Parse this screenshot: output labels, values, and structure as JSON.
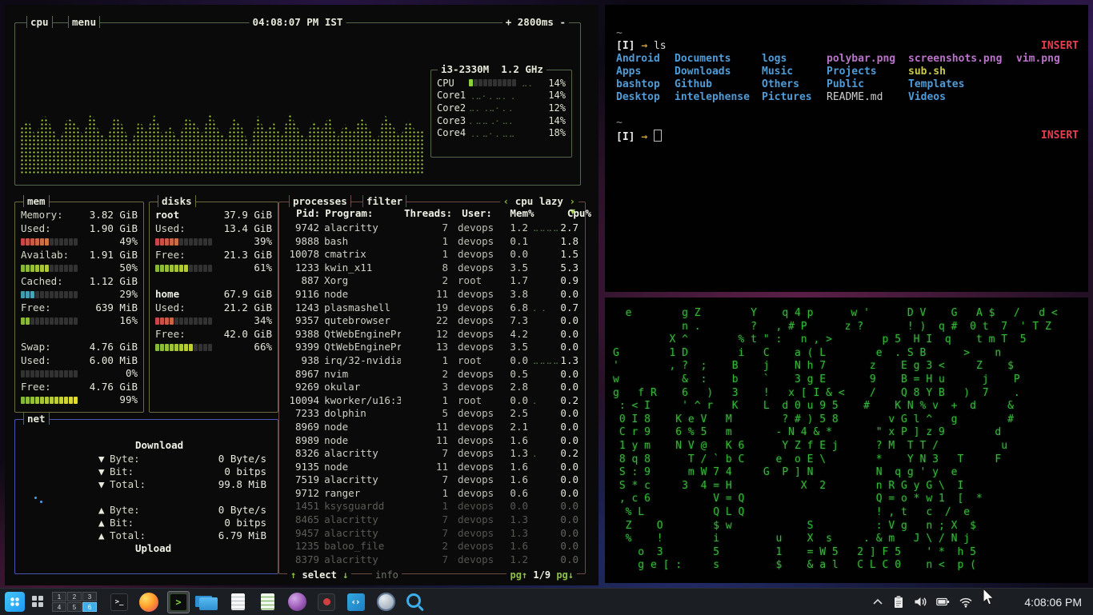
{
  "colors": {
    "accent_blue": "#3daee9",
    "bashtop_green": "#a9d23e",
    "insert_red": "#e3404f",
    "matrix_green": "#38b43c",
    "dir_blue": "#4f9cd8",
    "image_magenta": "#b973c8"
  },
  "bashtop": {
    "cpu_box": {
      "title": "cpu",
      "menu": "menu",
      "clock": "04:08:07 PM IST",
      "refresh": "+ 2800ms -",
      "model": "i3-2330M",
      "freq": "1.2 GHz",
      "legend": [
        {
          "label": "CPU",
          "pct": "14%",
          "meter": 14,
          "dots": "⣀⡀"
        },
        {
          "label": "Core1",
          "pct": "14%",
          "dots": "⢀⣀⠄⡀⣀⡀⢀"
        },
        {
          "label": "Core2",
          "pct": "12%",
          "dots": "⣀⡀⢀⣀⠄⡀⡀"
        },
        {
          "label": "Core3",
          "pct": "14%",
          "dots": "⡀⣀⣀⢀⠄⣀⡀"
        },
        {
          "label": "Core4",
          "pct": "18%",
          "dots": "⢀⡀⣀⠄⡀⣀⣀"
        }
      ],
      "graph_heights": [
        55,
        68,
        46,
        75,
        58,
        40,
        70,
        62,
        48,
        78,
        52,
        44,
        72,
        60,
        36,
        66,
        54,
        74,
        48,
        58,
        42,
        70,
        63,
        50,
        76,
        56,
        44,
        68,
        58,
        34,
        72,
        52,
        64,
        46,
        76,
        58,
        42,
        66,
        54,
        72,
        44,
        62,
        50,
        70,
        58,
        38,
        74,
        60,
        46,
        68,
        52,
        56
      ]
    },
    "mem_box": {
      "title": "mem",
      "lines": [
        {
          "label": "Memory:",
          "value": "3.82 GiB"
        },
        {
          "label": "Used:",
          "value": "1.90 GiB"
        },
        {
          "bar": 49,
          "ramp": "red",
          "pct": "49%"
        },
        {
          "label": "Availab:",
          "value": "1.91 GiB"
        },
        {
          "bar": 50,
          "ramp": "green",
          "pct": "50%"
        },
        {
          "label": "Cached:",
          "value": "1.12 GiB"
        },
        {
          "bar": 29,
          "ramp": "teal",
          "pct": "29%"
        },
        {
          "label": "Free:",
          "value": "639 MiB"
        },
        {
          "bar": 16,
          "ramp": "green",
          "pct": "16%"
        },
        {
          "blank": true
        },
        {
          "label": "Swap:",
          "value": "4.76 GiB"
        },
        {
          "label": "Used:",
          "value": "6.00 MiB"
        },
        {
          "bar": 0,
          "ramp": "green",
          "pct": "0%"
        },
        {
          "label": "Free:",
          "value": "4.76 GiB"
        },
        {
          "bar": 99,
          "ramp": "green",
          "pct": "99%"
        }
      ]
    },
    "disks_box": {
      "title": "disks",
      "lines": [
        {
          "label": "root",
          "value": "37.9 GiB",
          "bold": true
        },
        {
          "label": "Used:",
          "value": "13.4 GiB"
        },
        {
          "bar": 39,
          "ramp": "red",
          "pct": "39%"
        },
        {
          "label": "Free:",
          "value": "21.3 GiB"
        },
        {
          "bar": 61,
          "ramp": "green",
          "pct": "61%"
        },
        {
          "blank": true
        },
        {
          "label": "home",
          "value": "67.9 GiB",
          "bold": true
        },
        {
          "label": "Used:",
          "value": "21.2 GiB"
        },
        {
          "bar": 34,
          "ramp": "red",
          "pct": "34%"
        },
        {
          "label": "Free:",
          "value": "42.0 GiB"
        },
        {
          "bar": 66,
          "ramp": "green",
          "pct": "66%"
        }
      ]
    },
    "proc_box": {
      "title": "processes",
      "filter_label": "filter",
      "sort_prev": "‹",
      "sort_label": "cpu lazy",
      "sort_next": "›",
      "sort_caret": "▼",
      "header": {
        "pid": "Pid:",
        "prog": "Program:",
        "thr": "Threads:",
        "user": "User:",
        "mem": "Mem%",
        "cpu": "Cpu%"
      },
      "rows": [
        {
          "pid": "9742",
          "prog": "alacritty",
          "thr": "7",
          "user": "devops",
          "mem": "1.2",
          "g": "⣀⣀⣀⣀⣀",
          "cpu": "2.7"
        },
        {
          "pid": "9888",
          "prog": "bash",
          "thr": "1",
          "user": "devops",
          "mem": "0.1",
          "g": "",
          "cpu": "1.8"
        },
        {
          "pid": "10078",
          "prog": "cmatrix",
          "thr": "1",
          "user": "devops",
          "mem": "0.0",
          "g": "",
          "cpu": "1.5"
        },
        {
          "pid": "1233",
          "prog": "kwin_x11",
          "thr": "8",
          "user": "devops",
          "mem": "3.5",
          "g": "",
          "cpu": "5.3"
        },
        {
          "pid": "887",
          "prog": "Xorg",
          "thr": "2",
          "user": "root",
          "mem": "1.7",
          "g": "",
          "cpu": "0.9"
        },
        {
          "pid": "9116",
          "prog": "node",
          "thr": "11",
          "user": "devops",
          "mem": "3.8",
          "g": "",
          "cpu": "0.0"
        },
        {
          "pid": "1243",
          "prog": "plasmashell",
          "thr": "19",
          "user": "devops",
          "mem": "6.8",
          "g": "⡀⢀",
          "cpu": "0.7"
        },
        {
          "pid": "9357",
          "prog": "qutebrowser",
          "thr": "22",
          "user": "devops",
          "mem": "7.3",
          "g": "",
          "cpu": "0.0"
        },
        {
          "pid": "9388",
          "prog": "QtWebEnginePr",
          "thr": "12",
          "user": "devops",
          "mem": "4.2",
          "g": "",
          "cpu": "0.0"
        },
        {
          "pid": "9399",
          "prog": "QtWebEnginePr",
          "thr": "13",
          "user": "devops",
          "mem": "3.5",
          "g": "",
          "cpu": "0.0"
        },
        {
          "pid": "938",
          "prog": "irq/32-nvidia",
          "thr": "1",
          "user": "root",
          "mem": "0.0",
          "g": "⣀⣀⣀⣀",
          "cpu": "1.3"
        },
        {
          "pid": "8967",
          "prog": "nvim",
          "thr": "2",
          "user": "devops",
          "mem": "0.5",
          "g": "",
          "cpu": "0.0"
        },
        {
          "pid": "9269",
          "prog": "okular",
          "thr": "3",
          "user": "devops",
          "mem": "2.8",
          "g": "",
          "cpu": "0.0"
        },
        {
          "pid": "10094",
          "prog": "kworker/u16:3",
          "thr": "1",
          "user": "root",
          "mem": "0.0",
          "g": "⡀",
          "cpu": "0.2"
        },
        {
          "pid": "7233",
          "prog": "dolphin",
          "thr": "5",
          "user": "devops",
          "mem": "2.5",
          "g": "",
          "cpu": "0.0"
        },
        {
          "pid": "8969",
          "prog": "node",
          "thr": "11",
          "user": "devops",
          "mem": "2.1",
          "g": "",
          "cpu": "0.0"
        },
        {
          "pid": "8989",
          "prog": "node",
          "thr": "11",
          "user": "devops",
          "mem": "1.6",
          "g": "",
          "cpu": "0.0"
        },
        {
          "pid": "8326",
          "prog": "alacritty",
          "thr": "7",
          "user": "devops",
          "mem": "1.3",
          "g": "⡀",
          "cpu": "0.2"
        },
        {
          "pid": "9135",
          "prog": "node",
          "thr": "11",
          "user": "devops",
          "mem": "1.6",
          "g": "",
          "cpu": "0.0"
        },
        {
          "pid": "7519",
          "prog": "alacritty",
          "thr": "7",
          "user": "devops",
          "mem": "1.6",
          "g": "",
          "cpu": "0.0"
        },
        {
          "pid": "9712",
          "prog": "ranger",
          "thr": "1",
          "user": "devops",
          "mem": "0.6",
          "g": "",
          "cpu": "0.0"
        },
        {
          "pid": "1451",
          "prog": "ksysguardd",
          "thr": "1",
          "user": "devops",
          "mem": "0.0",
          "g": "",
          "cpu": "0.0",
          "dim": true
        },
        {
          "pid": "8465",
          "prog": "alacritty",
          "thr": "7",
          "user": "devops",
          "mem": "1.3",
          "g": "",
          "cpu": "0.0",
          "dim": true
        },
        {
          "pid": "9457",
          "prog": "alacritty",
          "thr": "7",
          "user": "devops",
          "mem": "1.3",
          "g": "",
          "cpu": "0.0",
          "dim": true
        },
        {
          "pid": "1235",
          "prog": "baloo_file",
          "thr": "2",
          "user": "devops",
          "mem": "1.6",
          "g": "",
          "cpu": "0.0",
          "dim": true
        },
        {
          "pid": "8379",
          "prog": "alacritty",
          "thr": "7",
          "user": "devops",
          "mem": "1.2",
          "g": "",
          "cpu": "0.0",
          "dim": true
        }
      ],
      "footer": {
        "up": "↑",
        "select": "select",
        "down": "↓",
        "info": "info",
        "pg_up": "pg↑",
        "page": "1/9",
        "pg_down": "pg↓"
      }
    },
    "net_box": {
      "title": "net",
      "download_label": "Download",
      "upload_label": "Upload",
      "down": [
        {
          "icon": "▼",
          "label": "Byte:",
          "value": "0 Byte/s"
        },
        {
          "icon": "▼",
          "label": "Bit:",
          "value": "0 bitps"
        },
        {
          "icon": "▼",
          "label": "Total:",
          "value": "99.8 MiB"
        }
      ],
      "up": [
        {
          "icon": "▲",
          "label": "Byte:",
          "value": "0 Byte/s"
        },
        {
          "icon": "▲",
          "label": "Bit:",
          "value": "0 bitps"
        },
        {
          "icon": "▲",
          "label": "Total:",
          "value": "6.79 MiB"
        }
      ]
    }
  },
  "shell": {
    "cwd": "~",
    "prompt_mode": "[I]",
    "prompt_arrow": "→",
    "command": "ls",
    "mode_indicator": "INSERT",
    "ls_columns": [
      73,
      109,
      81,
      102,
      135,
      70
    ],
    "ls_rows": [
      [
        {
          "t": "Android",
          "c": "dir"
        },
        {
          "t": "Documents",
          "c": "dir"
        },
        {
          "t": "logs",
          "c": "dir"
        },
        {
          "t": "polybar.png",
          "c": "img"
        },
        {
          "t": "screenshots.png",
          "c": "img"
        },
        {
          "t": "vim.png",
          "c": "img"
        }
      ],
      [
        {
          "t": "Apps",
          "c": "dir"
        },
        {
          "t": "Downloads",
          "c": "dir"
        },
        {
          "t": "Music",
          "c": "dir"
        },
        {
          "t": "Projects",
          "c": "dir"
        },
        {
          "t": "sub.sh",
          "c": "script"
        }
      ],
      [
        {
          "t": "bashtop",
          "c": "dir"
        },
        {
          "t": "Github",
          "c": "dir"
        },
        {
          "t": "Others",
          "c": "dir"
        },
        {
          "t": "Public",
          "c": "dir"
        },
        {
          "t": "Templates",
          "c": "dir"
        }
      ],
      [
        {
          "t": "Desktop",
          "c": "dir"
        },
        {
          "t": "intelephense",
          "c": "dir"
        },
        {
          "t": "Pictures",
          "c": "dir"
        },
        {
          "t": "README.md",
          "c": "file"
        },
        {
          "t": "Videos",
          "c": "dir"
        }
      ]
    ]
  },
  "matrix": {
    "lines": [
      "  e        g Z        Y    q 4 p      w '      D V    G   A $   /   d <",
      "           n .        ?   , # P      z ?       ! )  q #  0 t  7  ' T Z",
      "         X ^        % t \" :   n , >        p 5  H I  q    t m T  5",
      "G        1 D        i   C    a ( L        e  . S B      >    n",
      "'        , ?  ;    B    j    N h 7       z    E g 3 <     Z    $",
      "w          &  :    b    `    3 g E       9    B = H u      j    P",
      "g   f R    6   )   3    !   x [ I & <    /    Q 8 Y B   )  7    .",
      " : < I     ' ^ r   K    L  d 0 u 9 5    #    K N % v  +  d     &",
      " 0 I 8    K e V   M        ? # ) 5 8        v G l ^   g        #",
      " C r 9    6 % 5   m       - N 4 & *       \" x P ] z 9        d",
      " 1 y m    N V @   K 6      Y Z f E j      ? M  T T /          u",
      " 8 q 8      T / ` b C     e  o E \\        *    Y N 3   T     F",
      " S : 9      m W 7 4     G  P ] N          N  q g ' y  e",
      " S * c     3  4 = H           X  2        n R G y G \\  I",
      " , c 6          V = Q                     Q = o * w 1  [  *",
      "  % L           Q L Q                     ! , t   c  /  e",
      "  Z    O        $ w            S          : V g   n ; X  $",
      "  %    !        i         u    X  s     . & m   J \\ / N j",
      "    o  3        5         1    = W 5   2 ] F 5    ' *  h 5",
      "    g e [ :     s         $    & a l   C L C 0    n <  p ("
    ]
  },
  "taskbar": {
    "clock": "4:08:06 PM",
    "pager": [
      "1",
      "2",
      "3",
      "4",
      "5",
      "6"
    ],
    "pager_active": 5,
    "apps": [
      {
        "name": "konsole",
        "kind": "konsole"
      },
      {
        "name": "firefox",
        "kind": "firefox"
      },
      {
        "name": "terminal",
        "kind": "terminal",
        "active": true
      },
      {
        "name": "file-manager",
        "kind": "folder"
      },
      {
        "name": "text-editor",
        "kind": "doc"
      },
      {
        "name": "document-viewer",
        "kind": "doc-green"
      },
      {
        "name": "photo-app",
        "kind": "purple"
      },
      {
        "name": "okular",
        "kind": "dark-red"
      },
      {
        "name": "vscode",
        "kind": "vscode"
      },
      {
        "name": "qutebrowser",
        "kind": "globe"
      },
      {
        "name": "search-app",
        "kind": "search"
      }
    ]
  }
}
